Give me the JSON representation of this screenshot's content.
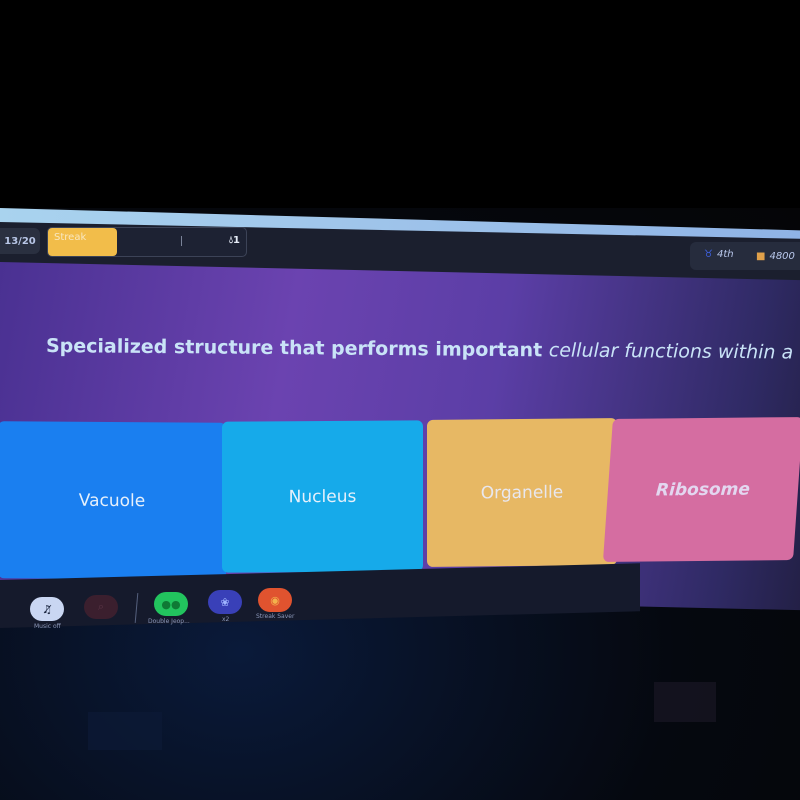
{
  "header": {
    "question_counter": "13/20",
    "streak": {
      "label": "Streak",
      "progress": 0.35,
      "count": "1",
      "icon": "flame-icon"
    },
    "rank": {
      "icon": "medal-icon",
      "value": "4th"
    },
    "points": {
      "icon": "coins-icon",
      "value": "4800"
    }
  },
  "question": {
    "text_regular": "Specialized structure that performs important ",
    "text_italic": "cellular functions within a cell"
  },
  "answers": [
    {
      "label": "Vacuole",
      "color": "#1a7ff0"
    },
    {
      "label": "Nucleus",
      "color": "#16aaea"
    },
    {
      "label": "Organelle",
      "color": "#e7b864"
    },
    {
      "label": "Ribosome",
      "color": "#d56da1"
    }
  ],
  "powerups": {
    "music": {
      "label": "Music off",
      "icon": "music-off-icon"
    },
    "zoom": {
      "icon": "zoom-icon"
    },
    "items": [
      {
        "label": "Double Jeop...",
        "icon": "double-jeopardy-icon",
        "color": "#22c45e"
      },
      {
        "label": "x2",
        "icon": "x2-icon",
        "color": "#3940b8"
      },
      {
        "label": "Streak Saver",
        "icon": "streak-saver-icon",
        "color": "#e0532f"
      }
    ]
  }
}
